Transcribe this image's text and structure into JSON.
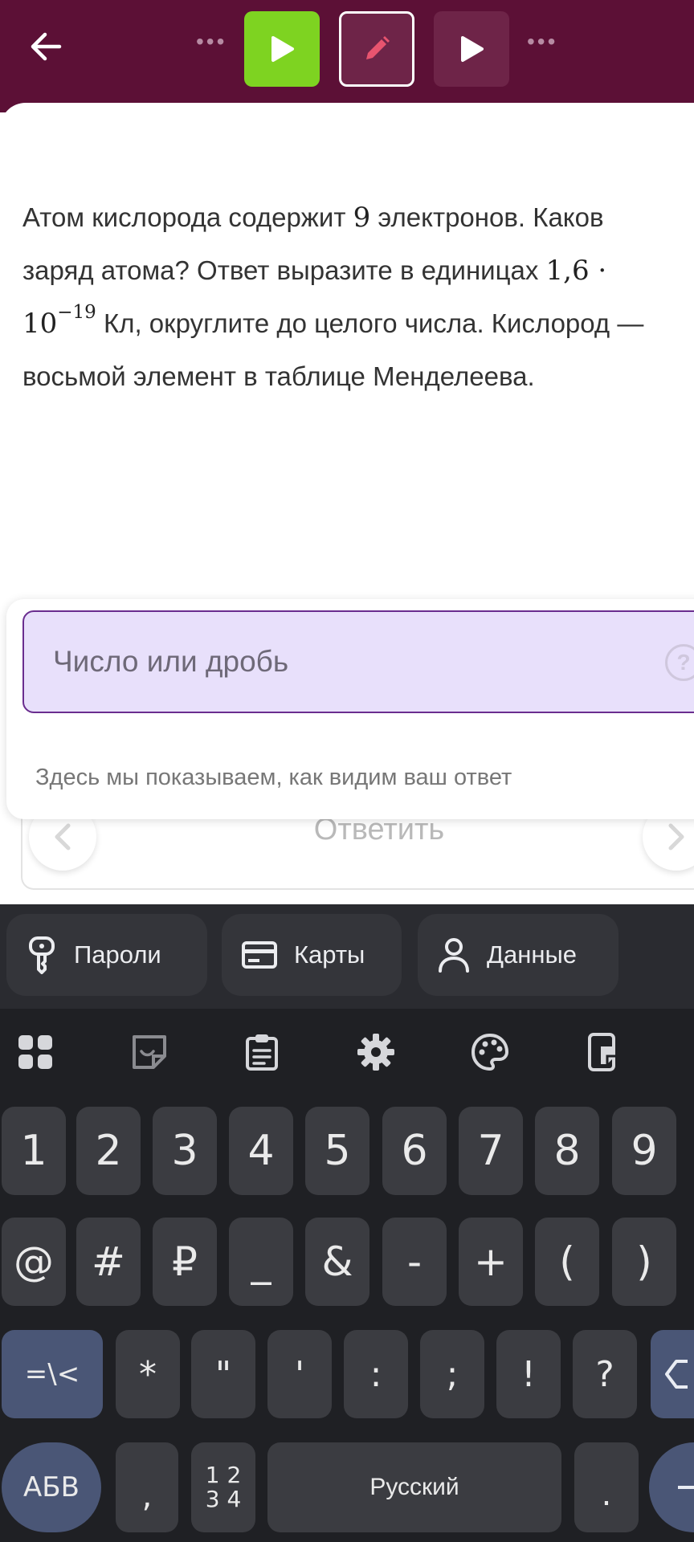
{
  "header": {
    "back_icon": "arrow-left-icon",
    "steps": [
      {
        "state": "done",
        "icon": "play-icon",
        "color": "#7ed321"
      },
      {
        "state": "current",
        "icon": "pencil-icon",
        "color": "#e8546f"
      },
      {
        "state": "next",
        "icon": "play-icon",
        "color": "#ffffff"
      }
    ],
    "background": "#5c1036"
  },
  "question": {
    "part1": "Атом кислорода содержит",
    "num_electrons": "9",
    "part2": "электронов. Каков заряд атома? Ответ выразите в единицах",
    "unit_mantissa": "1,6 · 10",
    "unit_exponent": "−19",
    "part3": "Кл, округлите до целого числа. Кислород — восьмой элемент в таблице Менделеева."
  },
  "answer": {
    "input_placeholder": "Число или дробь",
    "input_value": "",
    "help_glyph": "?",
    "preview_hint": "Здесь мы показываем, как видим ваш ответ",
    "submit_label": "Ответить"
  },
  "keyboard": {
    "autofill": [
      {
        "icon": "key-icon",
        "label": "Пароли"
      },
      {
        "icon": "credit-card-icon",
        "label": "Карты"
      },
      {
        "icon": "person-icon",
        "label": "Данные"
      }
    ],
    "toolbar": [
      "apps-grid-icon",
      "sticker-icon",
      "clipboard-icon",
      "gear-icon",
      "palette-icon",
      "phone-sticker-icon"
    ],
    "row_digits": [
      "1",
      "2",
      "3",
      "4",
      "5",
      "6",
      "7",
      "8",
      "9"
    ],
    "row_symbols": [
      "@",
      "#",
      "₽",
      "_",
      "&",
      "-",
      "+",
      "(",
      ")"
    ],
    "row_symbols2": [
      "=\\<",
      "*",
      "\"",
      "'",
      ":",
      ";",
      "!",
      "?"
    ],
    "bottom": {
      "abc": "АБВ",
      "comma": ",",
      "numpad_top": "1 2",
      "numpad_bottom": "3 4",
      "space": "Русский",
      "period": "."
    },
    "background": "#1f2024"
  }
}
